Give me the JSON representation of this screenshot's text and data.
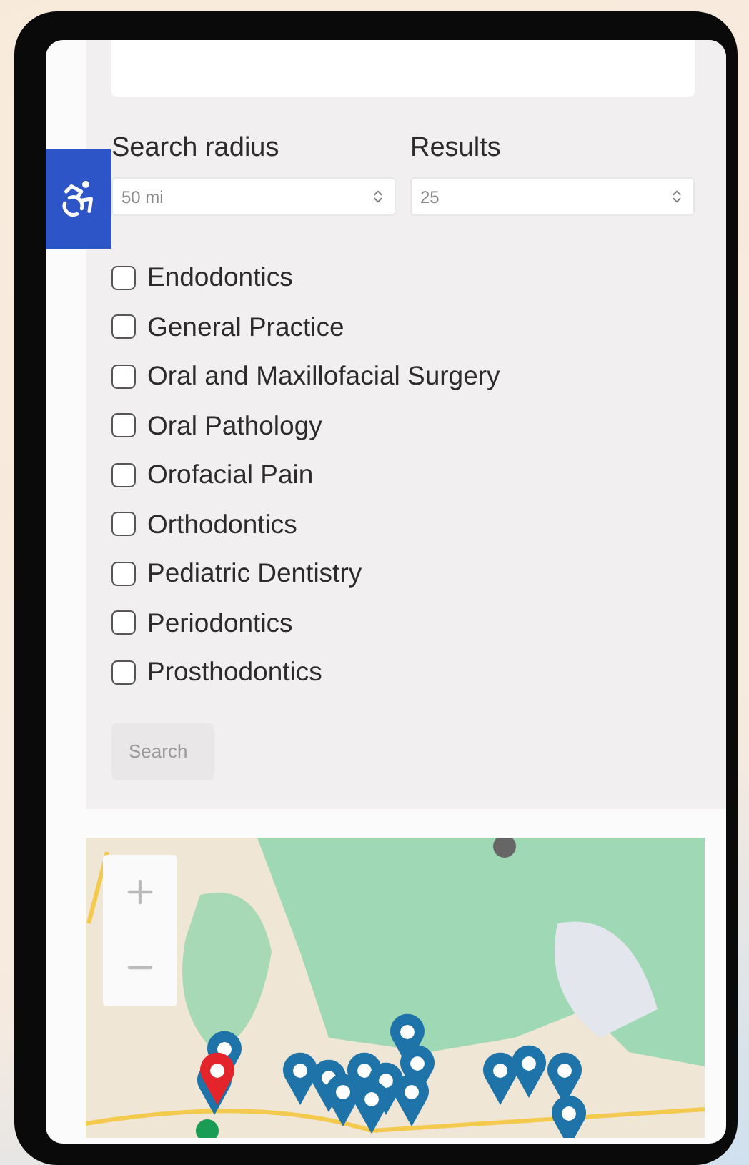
{
  "filters": {
    "search_radius": {
      "label": "Search radius",
      "value": "50 mi"
    },
    "results": {
      "label": "Results",
      "value": "25"
    }
  },
  "specialties": [
    {
      "label": "Endodontics",
      "checked": false
    },
    {
      "label": "General Practice",
      "checked": false
    },
    {
      "label": "Oral and Maxillofacial Surgery",
      "checked": false
    },
    {
      "label": "Oral Pathology",
      "checked": false
    },
    {
      "label": "Orofacial Pain",
      "checked": false
    },
    {
      "label": "Orthodontics",
      "checked": false
    },
    {
      "label": "Pediatric Dentistry",
      "checked": false
    },
    {
      "label": "Periodontics",
      "checked": false
    },
    {
      "label": "Prosthodontics",
      "checked": false
    }
  ],
  "search_button": {
    "label": "Search"
  }
}
